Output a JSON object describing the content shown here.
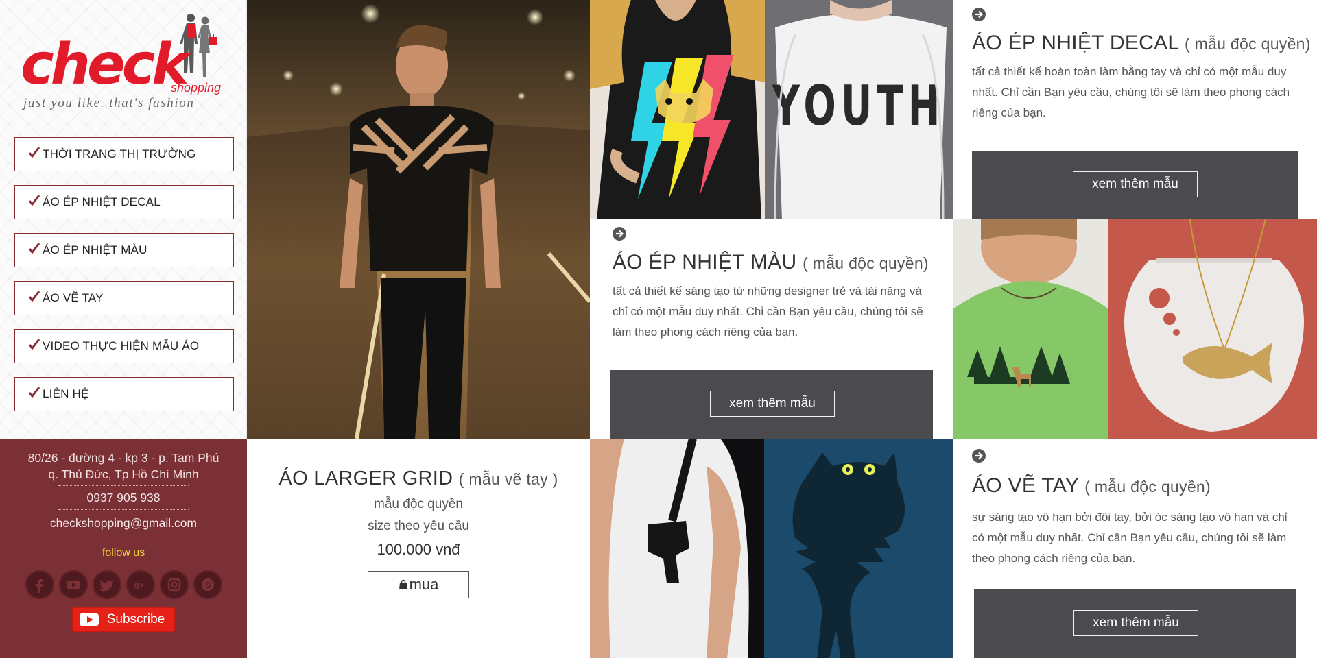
{
  "brand": {
    "logo_word": "check",
    "logo_sub": "shopping",
    "tagline": "just you like. that's fashion"
  },
  "menu": [
    {
      "label": "THỜI TRANG THỊ TRƯỜNG",
      "icon": "checkmark-icon"
    },
    {
      "label": "ÁO ÉP NHIỆT DECAL",
      "icon": "checkmark-icon"
    },
    {
      "label": "ÁO ÉP NHIỆT MÀU",
      "icon": "checkmark-icon"
    },
    {
      "label": "ÁO VẼ TAY",
      "icon": "checkmark-icon"
    },
    {
      "label": "VIDEO THỰC HIỆN MẪU ÁO",
      "icon": "checkmark-icon"
    },
    {
      "label": "LIÊN HỆ",
      "icon": "checkmark-icon"
    }
  ],
  "contact": {
    "address_line1": "80/26 - đường 4 - kp 3 - p. Tam Phú",
    "address_line2": "q. Thủ Đức, Tp Hồ Chí Minh",
    "phone": "0937 905 938",
    "email": "checkshopping@gmail.com",
    "follow_label": "follow us",
    "socials": [
      "facebook-icon",
      "youtube-icon",
      "twitter-icon",
      "google-plus-icon",
      "instagram-icon",
      "skype-icon"
    ],
    "subscribe_label": "Subscribe"
  },
  "features": {
    "decal": {
      "title": "ÁO ÉP NHIỆT DECAL",
      "subtitle": "( mẫu độc quyền)",
      "description": "tất cả thiết kế hoàn toàn làm bằng tay và chỉ có một mẫu duy nhất. Chỉ cần Bạn yêu cầu, chúng tôi sẽ làm theo phong cách riêng của bạn.",
      "button": "xem thêm mẫu"
    },
    "color": {
      "title": "ÁO ÉP NHIỆT MÀU",
      "subtitle": "( mẫu độc quyền)",
      "description": "tất cả thiết kế sáng tạo từ những designer trẻ và tài năng và chỉ có một mẫu duy nhất. Chỉ cần Bạn yêu cầu, chúng tôi sẽ làm theo phong cách riêng của bạn.",
      "button": "xem thêm mẫu"
    },
    "hand": {
      "title": "ÁO VẼ TAY",
      "subtitle": "( mẫu độc quyền)",
      "description": "sự sáng tạo vô hạn bởi đôi tay, bởi óc sáng tạo vô hạn và chỉ có một mẫu duy nhất. Chỉ cần Bạn yêu cầu, chúng tôi sẽ làm theo phong cách riêng của bạn.",
      "button": "xem thêm mẫu"
    }
  },
  "product": {
    "title": "ÁO LARGER GRID",
    "subtitle": "( mẫu vẽ tay )",
    "line1": "mẫu độc quyền",
    "line2": "size theo yêu cầu",
    "price": "100.000 vnđ",
    "buy_label": "mua"
  },
  "photos": {
    "youth_text": "YOUTH"
  },
  "colors": {
    "brand_red": "#e21b2b",
    "maroon": "#7b3036",
    "band_gray": "#4b4b4f",
    "follow_yellow": "#f2d436"
  }
}
